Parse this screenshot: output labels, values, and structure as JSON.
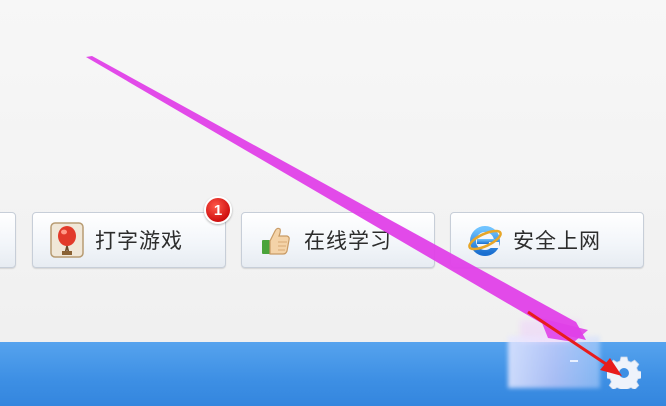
{
  "tiles": [
    {
      "id": "typing-game",
      "label": "打字游戏",
      "badge": "1",
      "icon": "balloon-icon"
    },
    {
      "id": "online-study",
      "label": "在线学习",
      "icon": "thumbs-up-icon"
    },
    {
      "id": "safe-browsing",
      "label": "安全上网",
      "icon": "ie-browser-icon"
    }
  ],
  "status_bar": {
    "settings_icon": "gear-icon"
  },
  "colors": {
    "status_bar": "#3d8fe4",
    "badge": "#d01010",
    "annotation_arrow": "#e040e8",
    "pointer_arrow": "#e81c1c"
  }
}
